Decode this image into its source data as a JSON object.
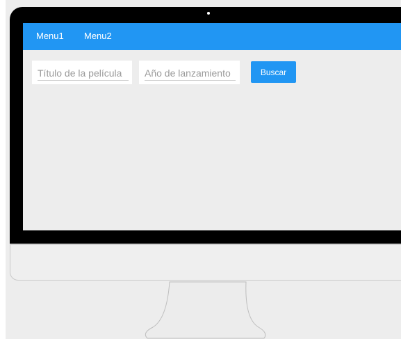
{
  "navbar": {
    "items": [
      {
        "label": "Menu1"
      },
      {
        "label": "Menu2"
      }
    ],
    "color": "#2196f3"
  },
  "search": {
    "title_placeholder": "Título de la película",
    "year_placeholder": "Año de lanzamiento",
    "button_label": "Buscar"
  },
  "device": {
    "type": "desktop-monitor",
    "bezel_color": "#000000",
    "screen_background": "#ededed"
  }
}
